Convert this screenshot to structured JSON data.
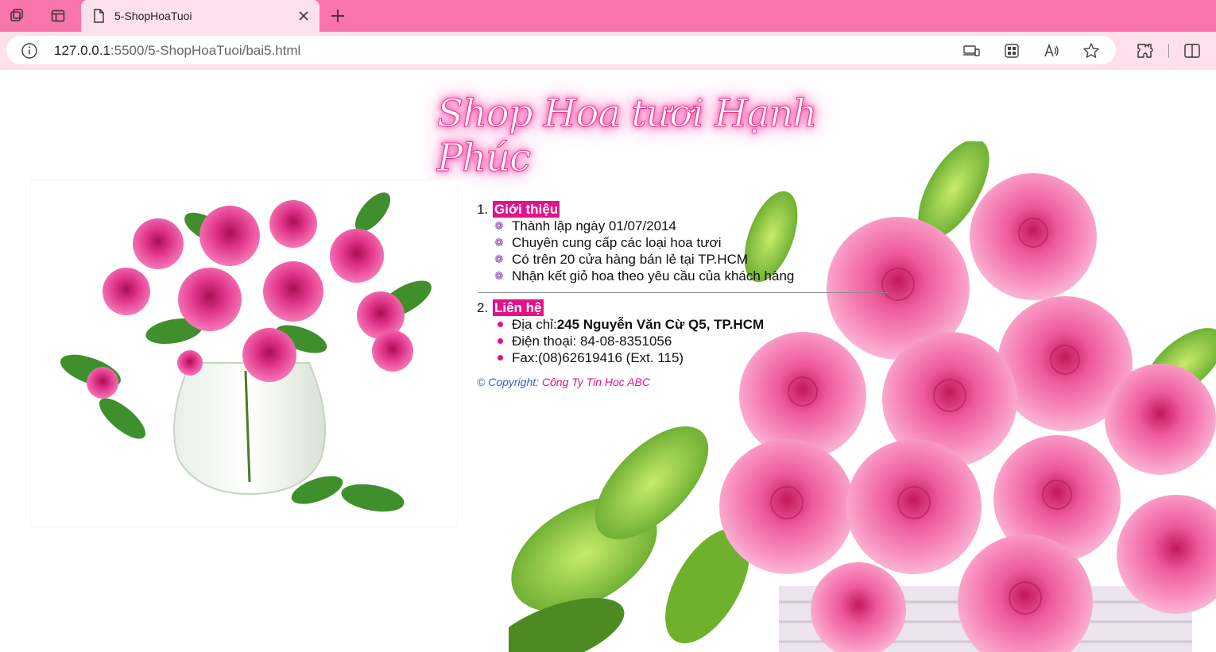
{
  "browser": {
    "tab_title": "5-ShopHoaTuoi",
    "url_host": "127.0.0.1",
    "url_rest": ":5500/5-ShopHoaTuoi/bai5.html"
  },
  "page": {
    "banner_title": "Shop Hoa tươi Hạnh Phúc",
    "sections": [
      {
        "number": "1.",
        "label": "Giới thiệu",
        "items": [
          "Thành lập ngày 01/07/2014",
          "Chuyên cung cấp các loại hoa tươi",
          "Có trên 20 cửa hàng bán lẻ tại TP.HCM",
          "Nhận kết giỏ hoa theo yêu cầu của khách hàng"
        ]
      },
      {
        "number": "2.",
        "label": "Liên hệ",
        "address_label": "Địa chỉ: ",
        "address_value": "245 Nguyễn Văn Cừ Q5, TP.HCM",
        "phone": "Điện thoại: 84-08-8351056",
        "fax": "Fax:(08)62619416 (Ext. 115)"
      }
    ],
    "copyright_prefix": "© Copyright: ",
    "copyright_company": "Công Ty Tin Hoc ABC"
  },
  "colors": {
    "tab_bar": "#f874ad",
    "address_bar": "#fde0ec",
    "label_bg": "#e3118a",
    "flower_bullet": "#8e44ad"
  }
}
